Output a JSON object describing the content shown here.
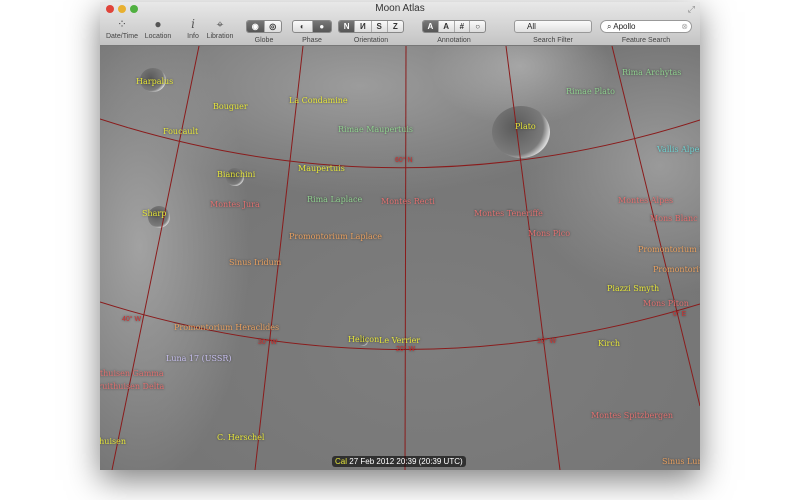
{
  "window": {
    "title": "Moon Atlas"
  },
  "toolbar": {
    "date_time": "Date/Time",
    "location": "Location",
    "info": "Info",
    "libration": "Libration",
    "globe": "Globe",
    "phase": "Phase",
    "orientation": {
      "label": "Orientation",
      "options": [
        "N",
        "И",
        "S",
        "Z"
      ],
      "selected": "N"
    },
    "annotation": {
      "label": "Annotation",
      "options": [
        "A",
        "A",
        "#",
        "○"
      ],
      "selected": 0
    },
    "search_filter": {
      "label": "Search Filter",
      "value": "All"
    },
    "feature_search": {
      "label": "Feature Search",
      "value": "Apollo"
    }
  },
  "map": {
    "features": [
      "Harpalus",
      "Bouguer",
      "La Condamine",
      "Foucault",
      "Rimae Maupertuis",
      "Bianchini",
      "Maupertuis",
      "Sharp",
      "Montes Jura",
      "Rima Laplace",
      "Montes Recti",
      "Promontorium Laplace",
      "Plato",
      "Rimae Plato",
      "Rima Archytas",
      "Vallis Alpes",
      "Montes Teneriffe",
      "Mons Pico",
      "Montes Alpes",
      "Mons Blanc",
      "Promontorium Deville",
      "Promontorium Agarum",
      "Piazzi Smyth",
      "Mons Piton",
      "Sinus Iridum",
      "Promontorium Heraclides",
      "Helicon",
      "Le Verrier",
      "Kirch",
      "Luna 17 (USSR)",
      "Gruithuisen Gamma",
      "Gruithuisen Delta",
      "Montes Spitzbergen",
      "Gruithuisen",
      "C. Herschel",
      "Sinus Lunicus"
    ],
    "grid_labels": [
      "60° N",
      "40° W",
      "30° W",
      "20° W",
      "10° W",
      "0° E"
    ],
    "status": {
      "prefix": "Cal",
      "datetime": "27 Feb 2012 20:39 (20:39 UTC)"
    }
  }
}
